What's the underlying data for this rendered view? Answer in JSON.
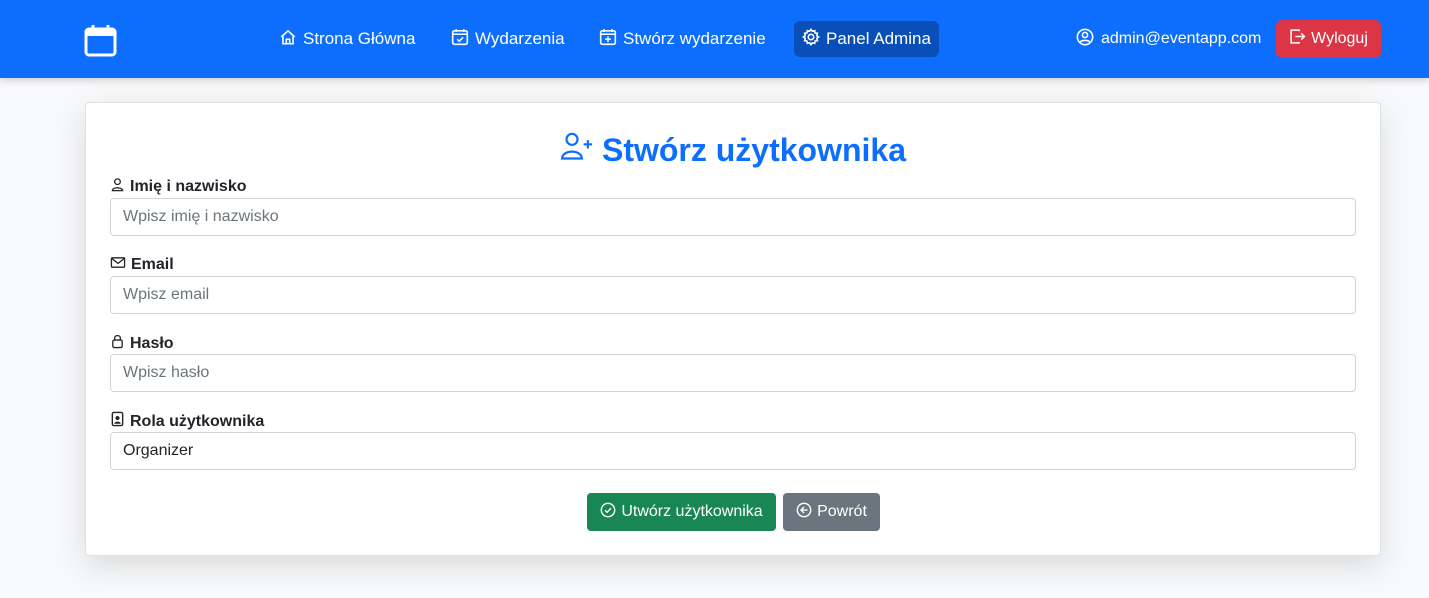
{
  "nav": {
    "brand_icon": "calendar-icon",
    "items": [
      {
        "label": "Strona Główna",
        "icon": "house-icon"
      },
      {
        "label": "Wydarzenia",
        "icon": "calendar-check-icon"
      },
      {
        "label": "Stwórz wydarzenie",
        "icon": "calendar-plus-icon"
      },
      {
        "label": "Panel Admina",
        "icon": "gear-icon",
        "active": true
      }
    ],
    "user_email": "admin@eventapp.com",
    "logout_label": "Wyloguj",
    "colors": {
      "navbar": "#0d6efd",
      "active": "#0a4fb8",
      "logout": "#dc3545"
    }
  },
  "form": {
    "title": "Stwórz użytkownika",
    "fields": [
      {
        "label": "Imię i nazwisko",
        "placeholder": "Wpisz imię i nazwisko",
        "value": "",
        "icon": "person-icon"
      },
      {
        "label": "Email",
        "placeholder": "Wpisz email",
        "value": "",
        "icon": "envelope-icon"
      },
      {
        "label": "Hasło",
        "placeholder": "Wpisz hasło",
        "value": "",
        "icon": "lock-icon"
      },
      {
        "label": "Rola użytkownika",
        "value": "Organizer",
        "icon": "person-badge-icon"
      }
    ],
    "submit_label": "Utwórz użytkownika",
    "back_label": "Powrót",
    "colors": {
      "title": "#0d6efd",
      "submit": "#198754",
      "back": "#6c757d"
    }
  }
}
